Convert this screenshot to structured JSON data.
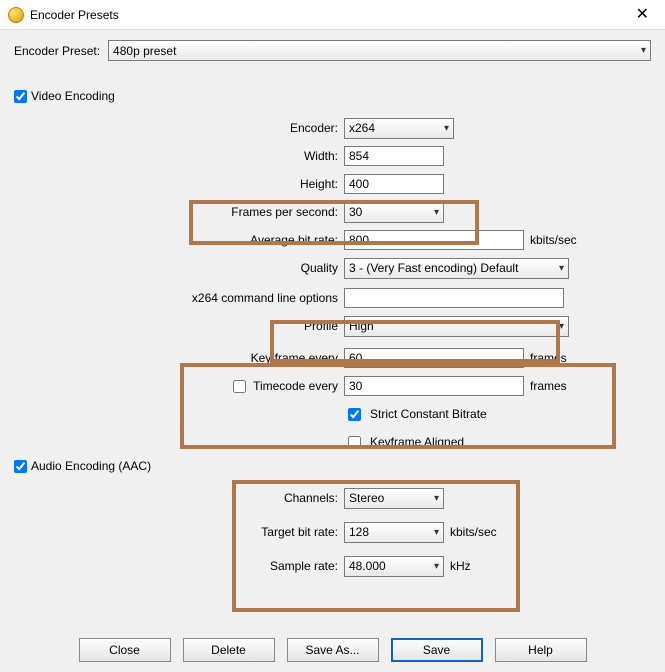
{
  "window": {
    "title": "Encoder Presets"
  },
  "presetRow": {
    "label": "Encoder Preset:",
    "value": "480p preset"
  },
  "video": {
    "section": "Video Encoding",
    "checked": true,
    "encoderLabel": "Encoder:",
    "encoder": "x264",
    "widthLabel": "Width:",
    "width": "854",
    "heightLabel": "Height:",
    "height": "400",
    "fpsLabel": "Frames per second:",
    "fps": "30",
    "avgBitrateLabel": "Average bit rate:",
    "avgBitrate": "800",
    "avgBitrateUnit": "kbits/sec",
    "qualityLabel": "Quality",
    "quality": "3 - (Very Fast encoding) Default",
    "cmdLabel": "x264 command line options",
    "cmd": "",
    "profileLabel": "Profile",
    "profile": "High",
    "keyframeLabel": "Key frame every",
    "keyframe": "60",
    "keyframeUnit": "frames",
    "timecodeLabel": "Timecode every",
    "timecodeChecked": false,
    "timecode": "30",
    "timecodeUnit": "frames",
    "strictCBR": "Strict Constant Bitrate",
    "strictCBRChecked": true,
    "keyAligned": "Keyframe Aligned",
    "keyAlignedChecked": false
  },
  "audio": {
    "section": "Audio Encoding (AAC)",
    "checked": true,
    "channelsLabel": "Channels:",
    "channels": "Stereo",
    "bitrateLabel": "Target bit rate:",
    "bitrate": "128",
    "bitrateUnit": "kbits/sec",
    "sampleLabel": "Sample rate:",
    "sample": "48.000",
    "sampleUnit": "kHz"
  },
  "buttons": {
    "close": "Close",
    "delete": "Delete",
    "saveAs": "Save As...",
    "save": "Save",
    "help": "Help"
  }
}
